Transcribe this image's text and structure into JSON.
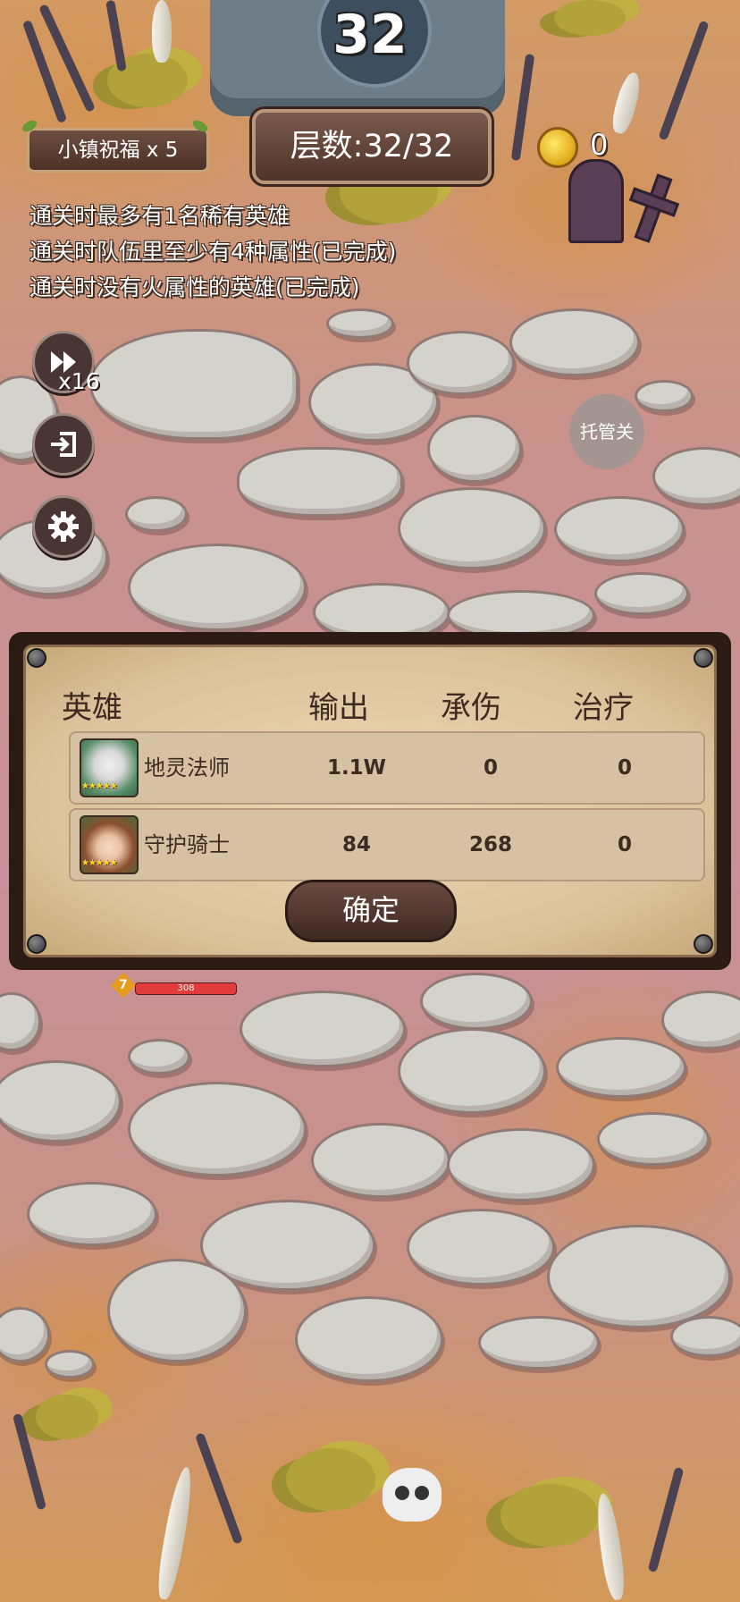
{
  "level": "32",
  "blessing": "小镇祝福 x 5",
  "floor_label": "层数:32/32",
  "coins": "0",
  "objectives": [
    "通关时最多有1名稀有英雄",
    "通关时队伍里至少有4种属性(已完成)",
    "通关时没有火属性的英雄(已完成)"
  ],
  "speed_label": "x16",
  "auto_label": "托管关",
  "hp_level": "7",
  "hp_value": "308",
  "results": {
    "headers": [
      "英雄",
      "输出",
      "承伤",
      "治疗"
    ],
    "rows": [
      {
        "name": "地灵法师",
        "damage": "1.1W",
        "taken": "0",
        "heal": "0",
        "stars": "★★★★★"
      },
      {
        "name": "守护骑士",
        "damage": "84",
        "taken": "268",
        "heal": "0",
        "stars": "★★★★★"
      }
    ],
    "confirm_label": "确定"
  },
  "icons": [
    "fast-forward-icon",
    "exit-icon",
    "gear-icon",
    "coin-icon",
    "skull-icon"
  ],
  "colors": {
    "panel": "#dbc29a",
    "text_dark": "#3f2a22",
    "hp": "#e23b3b",
    "coin": "#e0a817"
  }
}
